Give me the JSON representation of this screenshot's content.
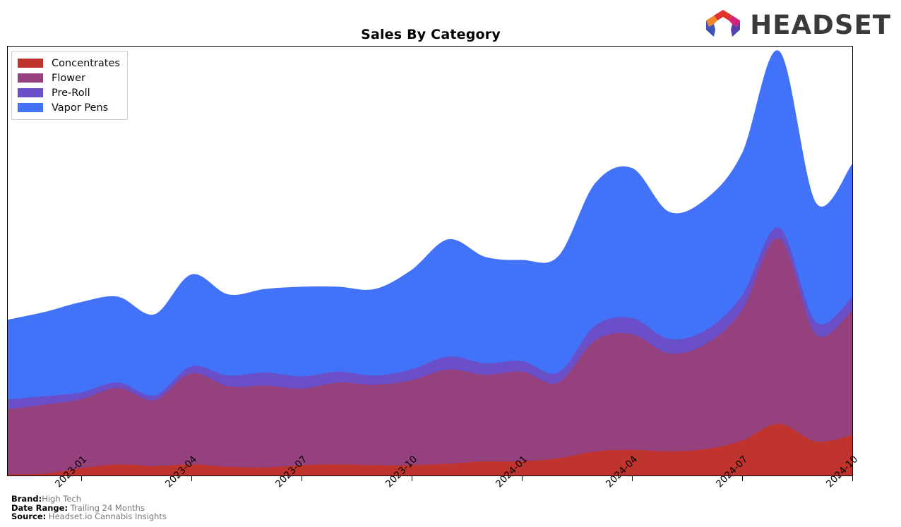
{
  "header": {
    "title": "Sales By Category",
    "logo": {
      "icon": "headset-hexagon-logo",
      "wordmark": "HEADSET",
      "colors": [
        "#f0882a",
        "#e0322f",
        "#d61f7a",
        "#7b3fc4",
        "#3a5fd9"
      ]
    }
  },
  "legend": {
    "position": "top-left",
    "items": [
      {
        "label": "Concentrates",
        "color": "#c0342e"
      },
      {
        "label": "Flower",
        "color": "#94417e"
      },
      {
        "label": "Pre-Roll",
        "color": "#6a4fc8"
      },
      {
        "label": "Vapor Pens",
        "color": "#4272f7"
      }
    ]
  },
  "footnotes": [
    {
      "key": "Brand:",
      "value": "High Tech"
    },
    {
      "key": "Date Range:",
      "value": "Trailing 24 Months"
    },
    {
      "key": "Source:",
      "value": "Headset.io Cannabis Insights"
    }
  ],
  "chart_data": {
    "type": "area",
    "stacked": true,
    "smoothing": "spline",
    "title": "Sales By Category",
    "xlabel": "",
    "ylabel": "",
    "grid": false,
    "legend_position": "top-left",
    "axis": {
      "x_tick_labels": [
        "2023-01",
        "2023-04",
        "2023-07",
        "2023-10",
        "2024-01",
        "2024-04",
        "2024-07",
        "2024-10"
      ],
      "x_tick_label_rotation": -45,
      "y_tick_labels": [],
      "y_axis_visible": false
    },
    "x": [
      "2022-11",
      "2022-12",
      "2023-01",
      "2023-02",
      "2023-03",
      "2023-04",
      "2023-05",
      "2023-06",
      "2023-07",
      "2023-08",
      "2023-09",
      "2023-10",
      "2023-11",
      "2023-12",
      "2024-01",
      "2024-02",
      "2024-03",
      "2024-04",
      "2024-05",
      "2024-06",
      "2024-07",
      "2024-08",
      "2024-09",
      "2024-10"
    ],
    "series": [
      {
        "name": "Concentrates",
        "color": "#c0342e",
        "values": [
          1,
          2,
          9,
          14,
          12,
          14,
          11,
          10,
          13,
          14,
          13,
          13,
          15,
          18,
          18,
          22,
          31,
          33,
          31,
          34,
          45,
          67,
          44,
          52
        ]
      },
      {
        "name": "Flower",
        "color": "#94417e",
        "values": [
          85,
          90,
          90,
          100,
          86,
          119,
          105,
          107,
          100,
          107,
          105,
          111,
          123,
          113,
          117,
          99,
          145,
          151,
          128,
          137,
          170,
          242,
          140,
          163
        ]
      },
      {
        "name": "Pre-Roll",
        "color": "#6a4fc8",
        "values": [
          13,
          11,
          9,
          7,
          6,
          9,
          14,
          17,
          16,
          14,
          12,
          14,
          17,
          15,
          14,
          13,
          19,
          21,
          19,
          18,
          19,
          14,
          16,
          17
        ]
      },
      {
        "name": "Vapor Pens",
        "color": "#4272f7",
        "values": [
          104,
          110,
          118,
          112,
          106,
          120,
          106,
          109,
          117,
          111,
          113,
          130,
          153,
          139,
          132,
          152,
          186,
          196,
          166,
          171,
          186,
          231,
          156,
          174
        ]
      }
    ],
    "y_max": 560
  }
}
